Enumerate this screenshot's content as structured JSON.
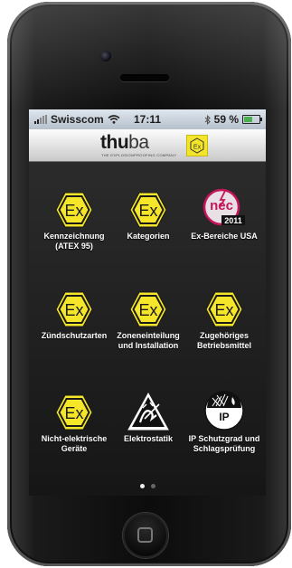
{
  "status_bar": {
    "carrier": "Swisscom",
    "time": "17:11",
    "battery_percent_text": "59 %",
    "battery_level": 0.59,
    "icons": [
      "signal-icon",
      "wifi-icon",
      "bluetooth-icon",
      "battery-icon"
    ]
  },
  "header": {
    "logo_bold": "thu",
    "logo_light": "ba",
    "logo_tagline": "THE EXPLOSIONPROOFING COMPANY",
    "badge_icon": "ex-badge-icon"
  },
  "menu": [
    {
      "label_line1": "Kennzeichnung",
      "label_line2": "(ATEX 95)",
      "icon": "ex-hexagon-icon"
    },
    {
      "label_line1": "Kategorien",
      "label_line2": "",
      "icon": "ex-hexagon-icon"
    },
    {
      "label_line1": "Ex-Bereiche USA",
      "label_line2": "",
      "icon": "nec-2011-icon"
    },
    {
      "label_line1": "Zündschutzarten",
      "label_line2": "",
      "icon": "ex-hexagon-icon"
    },
    {
      "label_line1": "Zoneneinteilung",
      "label_line2": "und Installation",
      "icon": "ex-hexagon-icon"
    },
    {
      "label_line1": "Zugehöriges",
      "label_line2": "Betriebsmittel",
      "icon": "ex-hexagon-icon"
    },
    {
      "label_line1": "Nicht-elektrische",
      "label_line2": "Geräte",
      "icon": "ex-hexagon-icon"
    },
    {
      "label_line1": "Elektrostatik",
      "label_line2": "",
      "icon": "esd-warning-icon"
    },
    {
      "label_line1": "IP Schutzgrad und",
      "label_line2": "Schlagsprüfung",
      "icon": "ip-shield-icon"
    }
  ],
  "ex_icon_text": "Ex",
  "nec_icon": {
    "text": "nec",
    "year": "2011"
  },
  "ip_icon_text": "IP",
  "pager": {
    "pages": 2,
    "current": 1
  },
  "colors": {
    "ex_yellow": "#f6e62a",
    "nec_magenta": "#c4155b",
    "background": "#1c1c1c"
  }
}
